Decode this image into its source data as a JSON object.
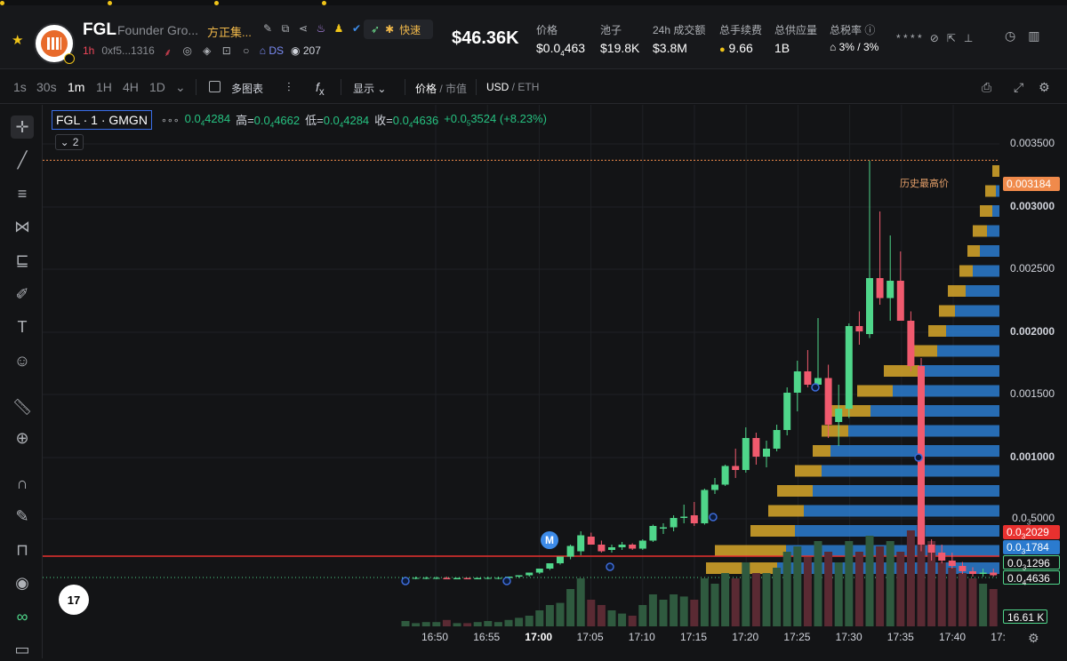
{
  "ticker": [
    {
      "name": "",
      "value": "",
      "change": ""
    },
    {
      "name": "",
      "value": "",
      "change": ""
    },
    {
      "name": "",
      "value": "",
      "change": ""
    },
    {
      "name": "",
      "value": "",
      "change": ""
    }
  ],
  "token": {
    "symbol": "FGL",
    "full_name": "Founder Gro...",
    "cn_name": "方正集...",
    "timeframe": "1h",
    "address": "0xf5...1316",
    "ds_label": "DS",
    "views": "207",
    "fast_label": "快速"
  },
  "market_cap": "$46.36K",
  "stats": {
    "price": {
      "label": "价格",
      "value_pre": "$0.0",
      "sub": "4",
      "value_post": "463"
    },
    "pool": {
      "label": "池子",
      "value": "$19.8K"
    },
    "volume": {
      "label": "24h 成交额",
      "value": "$3.8M"
    },
    "fees": {
      "label": "总手续费",
      "value": "9.66"
    },
    "supply": {
      "label": "总供应量",
      "value": "1B"
    },
    "tax": {
      "label": "总税率",
      "value": "3% / 3%"
    }
  },
  "toolbar": {
    "intervals": [
      "1s",
      "30s",
      "1m",
      "1H",
      "4H",
      "1D"
    ],
    "active_interval": "1m",
    "multi_chart": "多图表",
    "display": "显示",
    "price": "价格",
    "mcap": "市值",
    "usd": "USD",
    "eth": "ETH"
  },
  "legend": {
    "title": "FGL · 1 · GMGN",
    "open_val_pre": "0.0",
    "open_sub": "4",
    "open_val_post": "4284",
    "high_label": "高=",
    "high_pre": "0.0",
    "high_sub": "4",
    "high_post": "4662",
    "low_label": "低=",
    "low_pre": "0.0",
    "low_sub": "4",
    "low_post": "4284",
    "close_label": "收=",
    "close_pre": "0.0",
    "close_sub": "4",
    "close_post": "4636",
    "change_pre": "+0.0",
    "change_sub": "5",
    "change_post": "3524",
    "change_pct": "(+8.23%)",
    "collapse_count": "2"
  },
  "ath_label": "历史最高价",
  "m_marker": "M",
  "tv_logo": "17",
  "chart_data": {
    "type": "candlestick",
    "x_labels": [
      "16:50",
      "16:55",
      "17:00",
      "17:05",
      "17:10",
      "17:15",
      "17:20",
      "17:25",
      "17:30",
      "17:35",
      "17:40",
      "17:"
    ],
    "y_ticks": [
      {
        "v": "0.003500"
      },
      {
        "v": "0.003000"
      },
      {
        "v": "0.002500"
      },
      {
        "v": "0.002000"
      },
      {
        "v": "0.001500"
      },
      {
        "v": "0.001000"
      }
    ],
    "y_tick_sub": {
      "pre": "0.0",
      "sub": "3",
      "post": "5000"
    },
    "ylim": [
      0,
      0.0036
    ],
    "labels": {
      "ath": "0.003184",
      "red": {
        "pre": "0.0",
        "sub": "3",
        "post": "2029"
      },
      "blue": {
        "pre": "0.0",
        "sub": "3",
        "post": "1784"
      },
      "green1": {
        "pre": "0.0",
        "sub": "3",
        "post": "1296"
      },
      "green2": {
        "pre": "0.0",
        "sub": "4",
        "post": "4636"
      },
      "volume": "16.61 K"
    },
    "colors": {
      "up": "#4fd68a",
      "down": "#f05a6e",
      "ath": "#f08a4b",
      "red_line": "#e8312f",
      "vp_up": "#d8a72a",
      "vp_down": "#2b7bcf"
    },
    "candles": [
      {
        "t": "16:47",
        "o": 5e-05,
        "h": 6e-05,
        "l": 4e-05,
        "c": 5e-05
      },
      {
        "t": "16:48",
        "o": 5e-05,
        "h": 6e-05,
        "l": 4e-05,
        "c": 5e-05
      },
      {
        "t": "16:49",
        "o": 5e-05,
        "h": 6e-05,
        "l": 4e-05,
        "c": 5e-05
      },
      {
        "t": "16:50",
        "o": 5e-05,
        "h": 6e-05,
        "l": 4e-05,
        "c": 5e-05
      },
      {
        "t": "16:51",
        "o": 5e-05,
        "h": 6e-05,
        "l": 4e-05,
        "c": 4e-05
      },
      {
        "t": "16:52",
        "o": 4e-05,
        "h": 5e-05,
        "l": 4e-05,
        "c": 5e-05
      },
      {
        "t": "16:53",
        "o": 5e-05,
        "h": 5e-05,
        "l": 4e-05,
        "c": 4e-05
      },
      {
        "t": "16:54",
        "o": 4e-05,
        "h": 5e-05,
        "l": 4e-05,
        "c": 5e-05
      },
      {
        "t": "16:55",
        "o": 5e-05,
        "h": 6e-05,
        "l": 4e-05,
        "c": 5e-05
      },
      {
        "t": "16:56",
        "o": 5e-05,
        "h": 6e-05,
        "l": 4e-05,
        "c": 5e-05
      },
      {
        "t": "16:57",
        "o": 5e-05,
        "h": 6e-05,
        "l": 5e-05,
        "c": 6e-05
      },
      {
        "t": "16:58",
        "o": 6e-05,
        "h": 7e-05,
        "l": 5e-05,
        "c": 7e-05
      },
      {
        "t": "16:59",
        "o": 7e-05,
        "h": 9e-05,
        "l": 6e-05,
        "c": 9e-05
      },
      {
        "t": "17:00",
        "o": 9e-05,
        "h": 0.00012,
        "l": 8e-05,
        "c": 0.00012
      },
      {
        "t": "17:01",
        "o": 0.00012,
        "h": 0.00016,
        "l": 0.00011,
        "c": 0.00016
      },
      {
        "t": "17:02",
        "o": 0.00016,
        "h": 0.00021,
        "l": 0.00015,
        "c": 0.00021
      },
      {
        "t": "17:03",
        "o": 0.00021,
        "h": 0.0003,
        "l": 0.00019,
        "c": 0.00029
      },
      {
        "t": "17:04",
        "o": 0.00025,
        "h": 0.0004,
        "l": 0.00022,
        "c": 0.00037
      },
      {
        "t": "17:05",
        "o": 0.00036,
        "h": 0.00039,
        "l": 0.0003,
        "c": 0.0003
      },
      {
        "t": "17:06",
        "o": 0.0003,
        "h": 0.00033,
        "l": 0.00024,
        "c": 0.00025
      },
      {
        "t": "17:07",
        "o": 0.00026,
        "h": 0.0003,
        "l": 0.00024,
        "c": 0.00028
      },
      {
        "t": "17:08",
        "o": 0.00028,
        "h": 0.00032,
        "l": 0.00026,
        "c": 0.0003
      },
      {
        "t": "17:09",
        "o": 0.0003,
        "h": 0.00031,
        "l": 0.00026,
        "c": 0.00027
      },
      {
        "t": "17:10",
        "o": 0.00027,
        "h": 0.00034,
        "l": 0.00026,
        "c": 0.00033
      },
      {
        "t": "17:11",
        "o": 0.00033,
        "h": 0.00045,
        "l": 0.00032,
        "c": 0.00044
      },
      {
        "t": "17:12",
        "o": 0.00042,
        "h": 0.00046,
        "l": 0.00038,
        "c": 0.00043
      },
      {
        "t": "17:13",
        "o": 0.00043,
        "h": 0.00052,
        "l": 0.0004,
        "c": 0.0005
      },
      {
        "t": "17:14",
        "o": 0.0005,
        "h": 0.0006,
        "l": 0.00046,
        "c": 0.00051
      },
      {
        "t": "17:15",
        "o": 0.00052,
        "h": 0.00062,
        "l": 0.00044,
        "c": 0.00046
      },
      {
        "t": "17:16",
        "o": 0.00046,
        "h": 0.00072,
        "l": 0.00045,
        "c": 0.00071
      },
      {
        "t": "17:17",
        "o": 0.00071,
        "h": 0.0008,
        "l": 0.00068,
        "c": 0.00075
      },
      {
        "t": "17:18",
        "o": 0.00075,
        "h": 0.0009,
        "l": 0.00074,
        "c": 0.00089
      },
      {
        "t": "17:19",
        "o": 0.00089,
        "h": 0.00102,
        "l": 0.0008,
        "c": 0.00086
      },
      {
        "t": "17:20",
        "o": 0.00086,
        "h": 0.00118,
        "l": 0.00084,
        "c": 0.0011
      },
      {
        "t": "17:21",
        "o": 0.0011,
        "h": 0.00114,
        "l": 0.0009,
        "c": 0.00096
      },
      {
        "t": "17:22",
        "o": 0.00096,
        "h": 0.00108,
        "l": 0.00088,
        "c": 0.00102
      },
      {
        "t": "17:23",
        "o": 0.00102,
        "h": 0.0012,
        "l": 0.001,
        "c": 0.00116
      },
      {
        "t": "17:24",
        "o": 0.00116,
        "h": 0.00148,
        "l": 0.00112,
        "c": 0.00144
      },
      {
        "t": "17:25",
        "o": 0.00144,
        "h": 0.00168,
        "l": 0.0013,
        "c": 0.0016
      },
      {
        "t": "17:26",
        "o": 0.0016,
        "h": 0.00176,
        "l": 0.00148,
        "c": 0.0015
      },
      {
        "t": "17:27",
        "o": 0.0015,
        "h": 0.002,
        "l": 0.00146,
        "c": 0.00155
      },
      {
        "t": "17:28",
        "o": 0.00155,
        "h": 0.00165,
        "l": 0.0011,
        "c": 0.0012
      },
      {
        "t": "17:29",
        "o": 0.00122,
        "h": 0.0015,
        "l": 0.00104,
        "c": 0.00132
      },
      {
        "t": "17:30",
        "o": 0.00132,
        "h": 0.00196,
        "l": 0.00125,
        "c": 0.00194
      },
      {
        "t": "17:31",
        "o": 0.00194,
        "h": 0.00205,
        "l": 0.0018,
        "c": 0.0019
      },
      {
        "t": "17:32",
        "o": 0.00188,
        "h": 0.00318,
        "l": 0.00185,
        "c": 0.0023
      },
      {
        "t": "17:33",
        "o": 0.0023,
        "h": 0.0028,
        "l": 0.0021,
        "c": 0.00215
      },
      {
        "t": "17:34",
        "o": 0.00215,
        "h": 0.00262,
        "l": 0.00198,
        "c": 0.00228
      },
      {
        "t": "17:35",
        "o": 0.00228,
        "h": 0.0025,
        "l": 0.002,
        "c": 0.00198
      },
      {
        "t": "17:36",
        "o": 0.00198,
        "h": 0.00205,
        "l": 0.0016,
        "c": 0.00164
      },
      {
        "t": "17:37",
        "o": 0.00164,
        "h": 0.0017,
        "l": 0.00025,
        "c": 0.0003
      },
      {
        "t": "17:38",
        "o": 0.0003,
        "h": 0.00034,
        "l": 0.00018,
        "c": 0.00024
      },
      {
        "t": "17:39",
        "o": 0.00024,
        "h": 0.0003,
        "l": 0.00016,
        "c": 0.00018
      },
      {
        "t": "17:40",
        "o": 0.00018,
        "h": 0.00024,
        "l": 0.00012,
        "c": 0.00014
      },
      {
        "t": "17:41",
        "o": 0.00014,
        "h": 0.00017,
        "l": 8e-05,
        "c": 0.0001
      },
      {
        "t": "17:42",
        "o": 0.0001,
        "h": 0.00013,
        "l": 6e-05,
        "c": 8e-05
      },
      {
        "t": "17:43",
        "o": 8e-05,
        "h": 0.00012,
        "l": 6e-05,
        "c": 9e-05
      },
      {
        "t": "17:44",
        "o": 9e-05,
        "h": 0.00012,
        "l": 6e-05,
        "c": 7e-05
      },
      {
        "t": "17:45",
        "o": 7e-05,
        "h": 0.00015,
        "l": 6e-05,
        "c": 0.00014
      }
    ],
    "volume": [
      0.05,
      0.03,
      0.04,
      0.04,
      0.06,
      0.03,
      0.03,
      0.04,
      0.05,
      0.04,
      0.06,
      0.08,
      0.1,
      0.15,
      0.2,
      0.22,
      0.35,
      0.45,
      0.25,
      0.2,
      0.15,
      0.12,
      0.1,
      0.2,
      0.3,
      0.25,
      0.3,
      0.28,
      0.25,
      0.45,
      0.4,
      0.5,
      0.45,
      0.6,
      0.5,
      0.5,
      0.55,
      0.7,
      0.75,
      0.65,
      0.8,
      0.7,
      0.6,
      0.8,
      0.7,
      0.85,
      0.75,
      0.8,
      0.7,
      0.9,
      1.0,
      0.8,
      0.6,
      0.55,
      0.5,
      0.45,
      0.4,
      0.35,
      0.3,
      0.3
    ]
  }
}
